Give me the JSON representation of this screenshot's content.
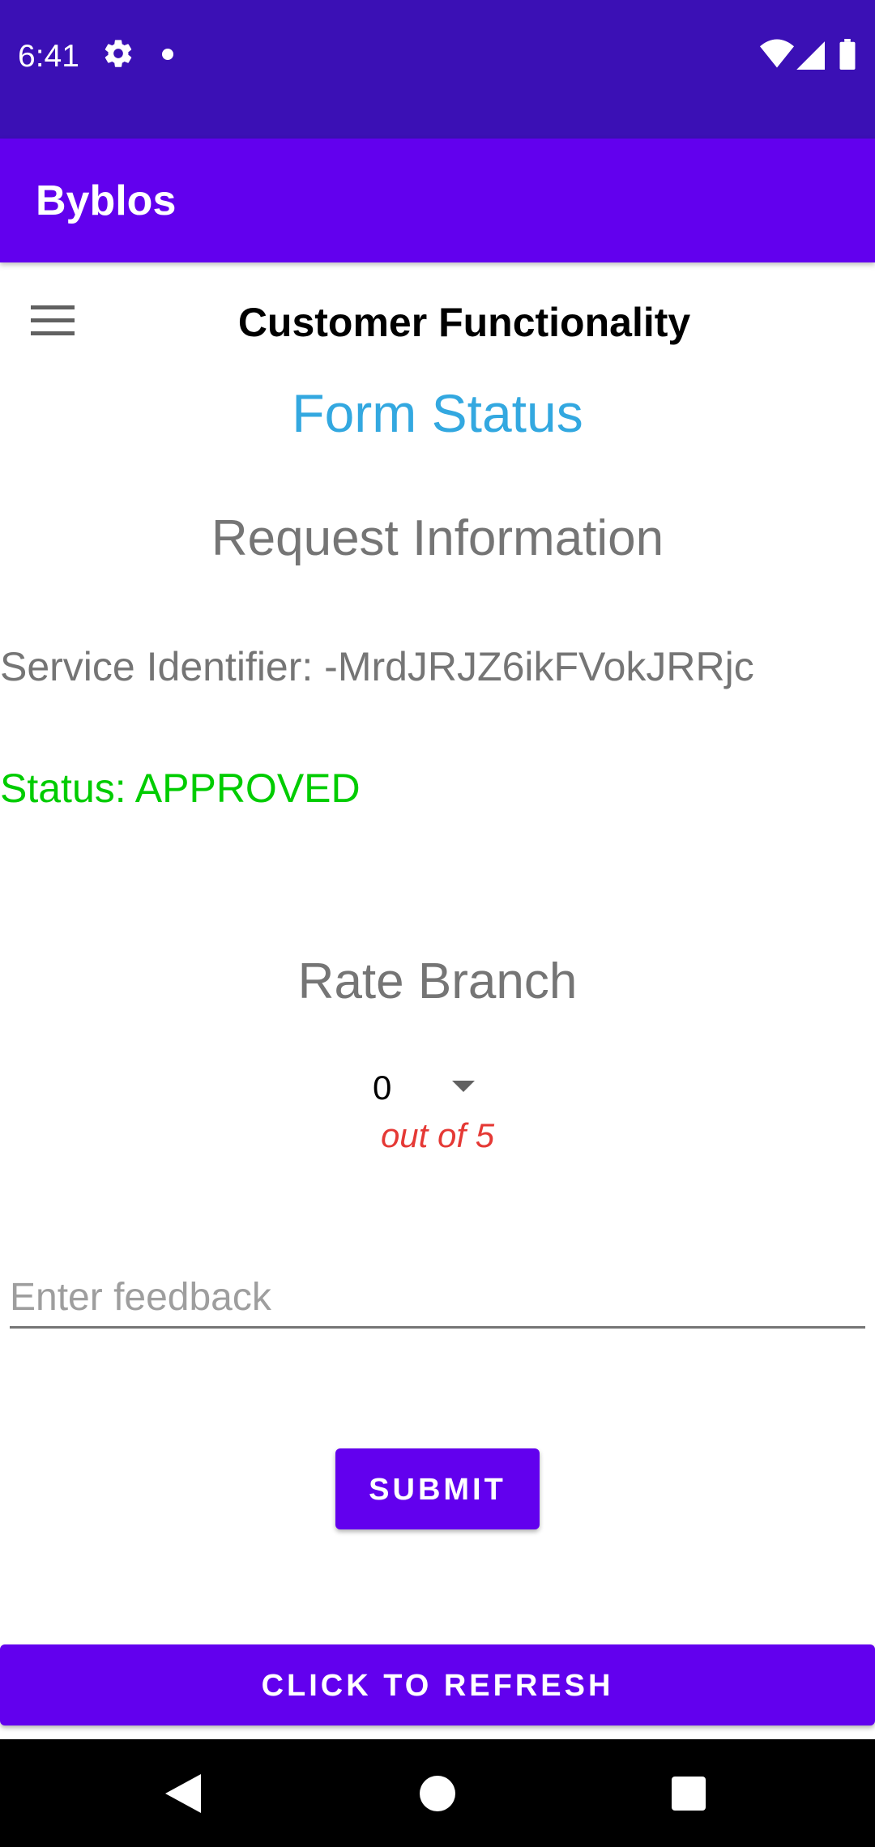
{
  "status_bar": {
    "time": "6:41",
    "icons": [
      "gear-icon",
      "notification-dot-icon",
      "wifi-icon",
      "cell-signal-icon",
      "battery-icon"
    ]
  },
  "app_bar": {
    "title": "Byblos"
  },
  "header": {
    "menu_icon": "hamburger-menu-icon",
    "title": "Customer Functionality"
  },
  "form": {
    "heading": "Form Status",
    "section_title": "Request Information",
    "service_identifier": "Service Identifier: -MrdJRJZ6ikFVokJRRjc",
    "status": "Status: APPROVED"
  },
  "rating": {
    "title": "Rate Branch",
    "selected_value": "0",
    "suffix": "out of 5"
  },
  "feedback": {
    "placeholder": "Enter feedback",
    "value": ""
  },
  "actions": {
    "submit_label": "SUBMIT",
    "refresh_label": "CLICK TO REFRESH"
  },
  "colors": {
    "status_bar": "#3b10b5",
    "primary": "#6200ee",
    "form_status": "#33a8e0",
    "approved": "#00cc00",
    "out_of": "#e53935"
  },
  "nav_bar": {
    "icons": [
      "back-icon",
      "home-icon",
      "recent-apps-icon"
    ]
  }
}
